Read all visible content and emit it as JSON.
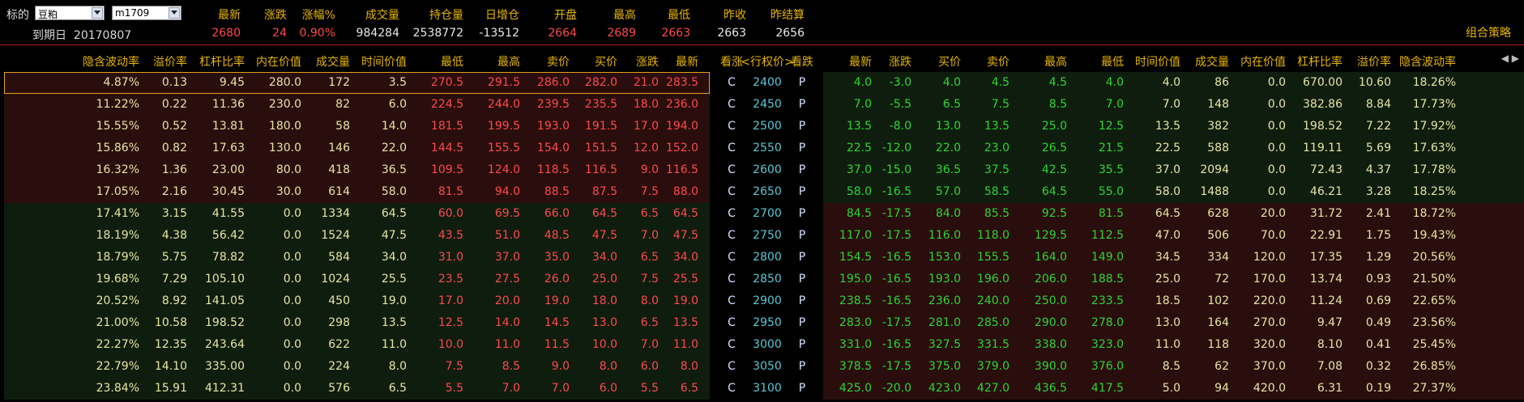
{
  "colors": {
    "header_label": "#e6b400",
    "up": "#ff4a4a",
    "down": "#2ed52e",
    "neutral": "#e8e8e8",
    "mid": "#d7e2ff",
    "strike": "#59c7d7",
    "call_itm_bg": "#2a0d0d",
    "call_otm_bg": "#0f1d0f",
    "put_itm_bg": "#2a0d0d",
    "put_otm_bg": "#0f1d0f",
    "selection": "#e2a01a"
  },
  "top": {
    "underlying_label": "标的",
    "underlying_select": "豆粕",
    "contract_select": "m1709",
    "expiry_label": "到期日",
    "expiry_value": "20170807",
    "combo_link": "组合策略",
    "quote_headers": [
      "最新",
      "涨跌",
      "涨幅%",
      "成交量",
      "持仓量",
      "日增仓",
      "开盘",
      "最高",
      "最低",
      "昨收",
      "昨结算"
    ],
    "quote_values": [
      "2680",
      "24",
      "0.90%",
      "984284",
      "2538772",
      "-13512",
      "2664",
      "2689",
      "2663",
      "2663",
      "2656"
    ],
    "quote_colors": [
      "up",
      "up",
      "up",
      "neutral",
      "neutral",
      "neutral",
      "up",
      "up",
      "up",
      "neutral",
      "neutral"
    ]
  },
  "table": {
    "call_headers": [
      "隐含波动率",
      "溢价率",
      "杠杆比率",
      "内在价值",
      "成交量",
      "时间价值",
      "最低",
      "最高",
      "卖价",
      "买价",
      "涨跌",
      "最新"
    ],
    "mid_headers": [
      "看涨",
      "<行权价>",
      "看跌"
    ],
    "put_headers": [
      "最新",
      "涨跌",
      "买价",
      "卖价",
      "最高",
      "最低",
      "时间价值",
      "成交量",
      "内在价值",
      "杠杆比率",
      "溢价率",
      "隐含波动率"
    ],
    "scroll_arrows": "◀ ▶",
    "rows": [
      {
        "strike": "2400",
        "c": "C",
        "p": "P",
        "call": [
          "4.87%",
          "0.13",
          "9.45",
          "280.0",
          "172",
          "3.5",
          "270.5",
          "291.5",
          "286.0",
          "282.0",
          "21.0",
          "283.5"
        ],
        "put": [
          "4.0",
          "-3.0",
          "4.0",
          "4.5",
          "4.5",
          "4.0",
          "4.0",
          "86",
          "0.0",
          "670.00",
          "10.60",
          "18.26%"
        ]
      },
      {
        "strike": "2450",
        "c": "C",
        "p": "P",
        "call": [
          "11.22%",
          "0.22",
          "11.36",
          "230.0",
          "82",
          "6.0",
          "224.5",
          "244.0",
          "239.5",
          "235.5",
          "18.0",
          "236.0"
        ],
        "put": [
          "7.0",
          "-5.5",
          "6.5",
          "7.5",
          "8.5",
          "7.0",
          "7.0",
          "148",
          "0.0",
          "382.86",
          "8.84",
          "17.73%"
        ]
      },
      {
        "strike": "2500",
        "c": "C",
        "p": "P",
        "call": [
          "15.55%",
          "0.52",
          "13.81",
          "180.0",
          "58",
          "14.0",
          "181.5",
          "199.5",
          "193.0",
          "191.5",
          "17.0",
          "194.0"
        ],
        "put": [
          "13.5",
          "-8.0",
          "13.0",
          "13.5",
          "25.0",
          "12.5",
          "13.5",
          "382",
          "0.0",
          "198.52",
          "7.22",
          "17.92%"
        ]
      },
      {
        "strike": "2550",
        "c": "C",
        "p": "P",
        "call": [
          "15.86%",
          "0.82",
          "17.63",
          "130.0",
          "146",
          "22.0",
          "144.5",
          "155.5",
          "154.0",
          "151.5",
          "12.0",
          "152.0"
        ],
        "put": [
          "22.5",
          "-12.0",
          "22.0",
          "23.0",
          "26.5",
          "21.5",
          "22.5",
          "588",
          "0.0",
          "119.11",
          "5.69",
          "17.63%"
        ]
      },
      {
        "strike": "2600",
        "c": "C",
        "p": "P",
        "call": [
          "16.32%",
          "1.36",
          "23.00",
          "80.0",
          "418",
          "36.5",
          "109.5",
          "124.0",
          "118.5",
          "116.5",
          "9.0",
          "116.5"
        ],
        "put": [
          "37.0",
          "-15.0",
          "36.5",
          "37.5",
          "42.5",
          "35.5",
          "37.0",
          "2094",
          "0.0",
          "72.43",
          "4.37",
          "17.78%"
        ]
      },
      {
        "strike": "2650",
        "c": "C",
        "p": "P",
        "call": [
          "17.05%",
          "2.16",
          "30.45",
          "30.0",
          "614",
          "58.0",
          "81.5",
          "94.0",
          "88.5",
          "87.5",
          "7.5",
          "88.0"
        ],
        "put": [
          "58.0",
          "-16.5",
          "57.0",
          "58.5",
          "64.5",
          "55.0",
          "58.0",
          "1488",
          "0.0",
          "46.21",
          "3.28",
          "18.25%"
        ]
      },
      {
        "strike": "2700",
        "c": "C",
        "p": "P",
        "call": [
          "17.41%",
          "3.15",
          "41.55",
          "0.0",
          "1334",
          "64.5",
          "60.0",
          "69.5",
          "66.0",
          "64.5",
          "6.5",
          "64.5"
        ],
        "put": [
          "84.5",
          "-17.5",
          "84.0",
          "85.5",
          "92.5",
          "81.5",
          "64.5",
          "628",
          "20.0",
          "31.72",
          "2.41",
          "18.72%"
        ]
      },
      {
        "strike": "2750",
        "c": "C",
        "p": "P",
        "call": [
          "18.19%",
          "4.38",
          "56.42",
          "0.0",
          "1524",
          "47.5",
          "43.5",
          "51.0",
          "48.5",
          "47.5",
          "7.0",
          "47.5"
        ],
        "put": [
          "117.0",
          "-17.5",
          "116.0",
          "118.0",
          "129.5",
          "112.5",
          "47.0",
          "506",
          "70.0",
          "22.91",
          "1.75",
          "19.43%"
        ]
      },
      {
        "strike": "2800",
        "c": "C",
        "p": "P",
        "call": [
          "18.79%",
          "5.75",
          "78.82",
          "0.0",
          "584",
          "34.0",
          "31.0",
          "37.0",
          "35.0",
          "34.0",
          "6.5",
          "34.0"
        ],
        "put": [
          "154.5",
          "-16.5",
          "153.0",
          "155.5",
          "164.0",
          "149.0",
          "34.5",
          "334",
          "120.0",
          "17.35",
          "1.29",
          "20.56%"
        ]
      },
      {
        "strike": "2850",
        "c": "C",
        "p": "P",
        "call": [
          "19.68%",
          "7.29",
          "105.10",
          "0.0",
          "1024",
          "25.5",
          "23.5",
          "27.5",
          "26.0",
          "25.0",
          "7.5",
          "25.5"
        ],
        "put": [
          "195.0",
          "-16.5",
          "193.0",
          "196.0",
          "206.0",
          "188.5",
          "25.0",
          "72",
          "170.0",
          "13.74",
          "0.93",
          "21.50%"
        ]
      },
      {
        "strike": "2900",
        "c": "C",
        "p": "P",
        "call": [
          "20.52%",
          "8.92",
          "141.05",
          "0.0",
          "450",
          "19.0",
          "17.0",
          "20.0",
          "19.0",
          "18.0",
          "8.0",
          "19.0"
        ],
        "put": [
          "238.5",
          "-16.5",
          "236.0",
          "240.0",
          "250.0",
          "233.5",
          "18.5",
          "102",
          "220.0",
          "11.24",
          "0.69",
          "22.65%"
        ]
      },
      {
        "strike": "2950",
        "c": "C",
        "p": "P",
        "call": [
          "21.00%",
          "10.58",
          "198.52",
          "0.0",
          "298",
          "13.5",
          "12.5",
          "14.0",
          "14.5",
          "13.0",
          "6.5",
          "13.5"
        ],
        "put": [
          "283.0",
          "-17.5",
          "281.0",
          "285.0",
          "290.0",
          "278.0",
          "13.0",
          "164",
          "270.0",
          "9.47",
          "0.49",
          "23.56%"
        ]
      },
      {
        "strike": "3000",
        "c": "C",
        "p": "P",
        "call": [
          "22.27%",
          "12.35",
          "243.64",
          "0.0",
          "622",
          "11.0",
          "10.0",
          "11.0",
          "11.5",
          "10.0",
          "7.0",
          "11.0"
        ],
        "put": [
          "331.0",
          "-16.5",
          "327.5",
          "331.5",
          "338.0",
          "323.0",
          "11.0",
          "118",
          "320.0",
          "8.10",
          "0.41",
          "25.45%"
        ]
      },
      {
        "strike": "3050",
        "c": "C",
        "p": "P",
        "call": [
          "22.79%",
          "14.10",
          "335.00",
          "0.0",
          "224",
          "8.0",
          "7.5",
          "8.5",
          "9.0",
          "8.0",
          "6.0",
          "8.0"
        ],
        "put": [
          "378.5",
          "-17.5",
          "375.0",
          "379.0",
          "390.0",
          "376.0",
          "8.5",
          "62",
          "370.0",
          "7.08",
          "0.32",
          "26.85%"
        ]
      },
      {
        "strike": "3100",
        "c": "C",
        "p": "P",
        "call": [
          "23.84%",
          "15.91",
          "412.31",
          "0.0",
          "576",
          "6.5",
          "5.5",
          "7.0",
          "7.0",
          "6.0",
          "5.5",
          "6.5"
        ],
        "put": [
          "425.0",
          "-20.0",
          "423.0",
          "427.0",
          "436.5",
          "417.5",
          "5.0",
          "94",
          "420.0",
          "6.31",
          "0.19",
          "27.37%"
        ]
      }
    ]
  }
}
